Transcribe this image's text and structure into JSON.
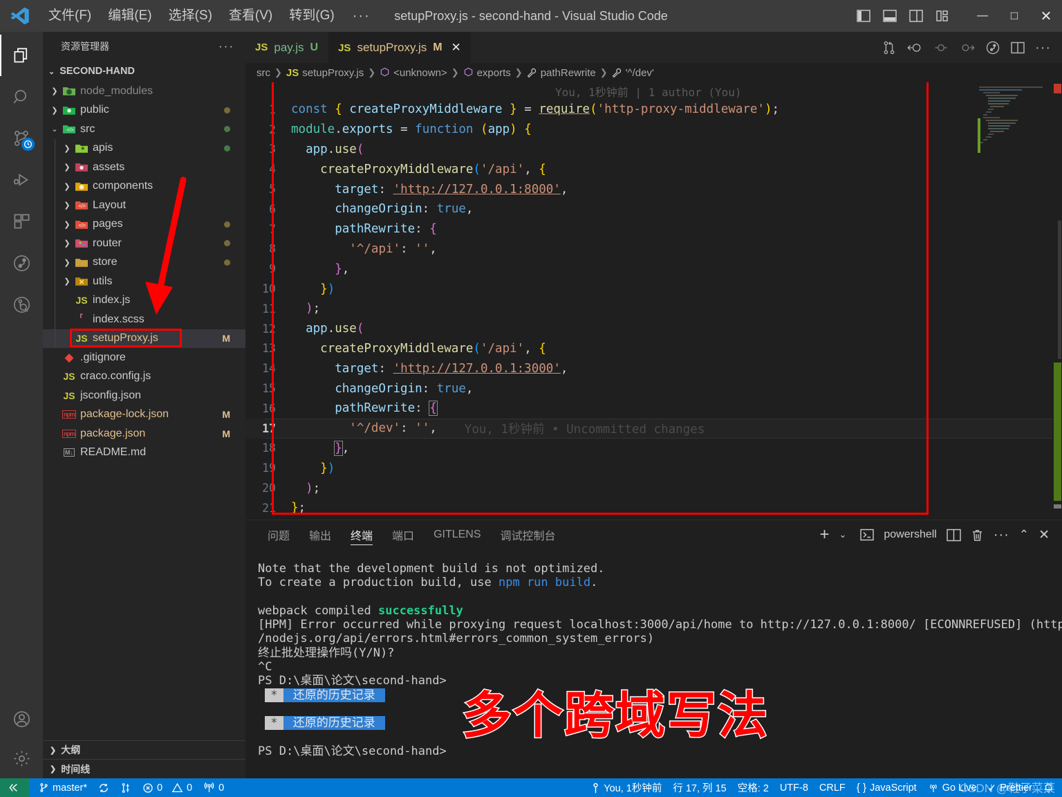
{
  "window": {
    "title": "setupProxy.js - second-hand - Visual Studio Code",
    "menus": [
      "文件(F)",
      "编辑(E)",
      "选择(S)",
      "查看(V)",
      "转到(G)",
      "···"
    ],
    "controls": {
      "minimize": "—",
      "maximize": "□",
      "close": "✕"
    }
  },
  "activitybar": {
    "items": [
      {
        "name": "explorer",
        "icon": "files-icon"
      },
      {
        "name": "search",
        "icon": "search-icon"
      },
      {
        "name": "source-control",
        "icon": "source-control-icon",
        "badge": "clock"
      },
      {
        "name": "run-debug",
        "icon": "run-debug-icon"
      },
      {
        "name": "extensions",
        "icon": "extensions-icon"
      },
      {
        "name": "gitlens",
        "icon": "gitlens-icon"
      },
      {
        "name": "gitlens-inspect",
        "icon": "gitlens-inspect-icon"
      }
    ],
    "bottom": [
      {
        "name": "accounts",
        "icon": "account-icon"
      },
      {
        "name": "settings",
        "icon": "gear-icon"
      }
    ]
  },
  "sidebar": {
    "header": "资源管理器",
    "header_more": "···",
    "root": "SECOND-HAND",
    "tree": [
      {
        "label": "node_modules",
        "depth": 1,
        "type": "folder",
        "icon": "folder-node",
        "expandable": true,
        "expanded": false,
        "dim": true
      },
      {
        "label": "public",
        "depth": 1,
        "type": "folder",
        "icon": "folder-public",
        "expandable": true,
        "expanded": false,
        "dot": "#7a6a3a"
      },
      {
        "label": "src",
        "depth": 1,
        "type": "folder",
        "icon": "folder-src",
        "expandable": true,
        "expanded": true,
        "dot": "#487a48"
      },
      {
        "label": "apis",
        "depth": 2,
        "type": "folder",
        "icon": "folder-api",
        "expandable": true,
        "expanded": false,
        "dot": "#487a48"
      },
      {
        "label": "assets",
        "depth": 2,
        "type": "folder",
        "icon": "folder-assets",
        "expandable": true,
        "expanded": false
      },
      {
        "label": "components",
        "depth": 2,
        "type": "folder",
        "icon": "folder-components",
        "expandable": true,
        "expanded": false
      },
      {
        "label": "Layout",
        "depth": 2,
        "type": "folder",
        "icon": "folder-layout",
        "expandable": true,
        "expanded": false
      },
      {
        "label": "pages",
        "depth": 2,
        "type": "folder",
        "icon": "folder-pages",
        "expandable": true,
        "expanded": false,
        "dot": "#7a6a3a"
      },
      {
        "label": "router",
        "depth": 2,
        "type": "folder",
        "icon": "folder-router",
        "expandable": true,
        "expanded": false,
        "dot": "#7a6a3a"
      },
      {
        "label": "store",
        "depth": 2,
        "type": "folder",
        "icon": "folder-store",
        "expandable": true,
        "expanded": false,
        "dot": "#7a6a3a"
      },
      {
        "label": "utils",
        "depth": 2,
        "type": "folder",
        "icon": "folder-utils",
        "expandable": true,
        "expanded": false
      },
      {
        "label": "index.js",
        "depth": 2,
        "type": "file",
        "icon": "js-icon"
      },
      {
        "label": "index.scss",
        "depth": 2,
        "type": "file",
        "icon": "scss-icon"
      },
      {
        "label": "setupProxy.js",
        "depth": 2,
        "type": "file",
        "icon": "js-icon",
        "badge": "M",
        "selected": true,
        "highlighted": true
      },
      {
        "label": ".gitignore",
        "depth": 1,
        "type": "file",
        "icon": "git-icon"
      },
      {
        "label": "craco.config.js",
        "depth": 1,
        "type": "file",
        "icon": "js-icon"
      },
      {
        "label": "jsconfig.json",
        "depth": 1,
        "type": "file",
        "icon": "jsconfig-icon"
      },
      {
        "label": "package-lock.json",
        "depth": 1,
        "type": "file",
        "icon": "npm-icon",
        "badge": "M"
      },
      {
        "label": "package.json",
        "depth": 1,
        "type": "file",
        "icon": "npm-icon",
        "badge": "M"
      },
      {
        "label": "README.md",
        "depth": 1,
        "type": "file",
        "icon": "markdown-icon"
      }
    ],
    "sections": [
      "大纲",
      "时间线"
    ]
  },
  "tabs": [
    {
      "label": "pay.js",
      "icon": "js-icon",
      "status": "U",
      "active": false
    },
    {
      "label": "setupProxy.js",
      "icon": "js-icon",
      "status": "M",
      "active": true,
      "close": "✕"
    }
  ],
  "editor_actions": [
    {
      "name": "compare-changes-icon"
    },
    {
      "name": "gitlens-open-revision-icon"
    },
    {
      "name": "gitlens-previous-icon"
    },
    {
      "name": "gitlens-next-icon"
    },
    {
      "name": "gitlens-toggle-blame-icon"
    },
    {
      "name": "split-editor-icon"
    },
    {
      "name": "more-actions-icon"
    }
  ],
  "breadcrumbs": [
    {
      "label": "src",
      "icon": null
    },
    {
      "label": "setupProxy.js",
      "icon": "js-icon"
    },
    {
      "label": "<unknown>",
      "icon": "symbol-module-icon"
    },
    {
      "label": "exports",
      "icon": "symbol-module-icon"
    },
    {
      "label": "pathRewrite",
      "icon": "symbol-property-icon"
    },
    {
      "label": "'^/dev'",
      "icon": "symbol-property-icon"
    }
  ],
  "editor": {
    "blame_header": "You, 1秒钟前 | 1 author (You)",
    "inline_blame": "You, 1秒钟前 • Uncommitted changes",
    "current_line": 17,
    "lines": [
      {
        "n": 1,
        "git": "",
        "html": "<span class=\"k-const\">const</span> <span class=\"b1\">{</span> <span class=\"k-var\">createProxyMiddleware</span> <span class=\"b1\">}</span> <span class=\"k-plain\">=</span> <span class=\"k-fn link\">require</span><span class=\"b1\">(</span><span class=\"k-str\">'http-proxy-middleware'</span><span class=\"b1\">)</span><span class=\"k-plain\">;</span>"
      },
      {
        "n": 2,
        "git": "",
        "html": "<span class=\"k-ident\">module</span><span class=\"k-plain\">.</span><span class=\"k-var\">exports</span> <span class=\"k-plain\">=</span> <span class=\"k-const\">function</span> <span class=\"b1\">(</span><span class=\"k-var\">app</span><span class=\"b1\">)</span> <span class=\"b1\">{</span>"
      },
      {
        "n": 3,
        "git": "",
        "html": "  <span class=\"k-var\">app</span><span class=\"k-plain\">.</span><span class=\"k-fn\">use</span><span class=\"b2\">(</span>"
      },
      {
        "n": 4,
        "git": "",
        "html": "    <span class=\"k-fn\">createProxyMiddleware</span><span class=\"b3\">(</span><span class=\"k-str\">'/api'</span><span class=\"k-plain\">,</span> <span class=\"b1\">{</span>"
      },
      {
        "n": 5,
        "git": "",
        "html": "      <span class=\"k-prop\">target</span><span class=\"k-plain\">:</span> <span class=\"k-str link\">'http://127.0.0.1:8000'</span><span class=\"k-plain\">,</span>"
      },
      {
        "n": 6,
        "git": "",
        "html": "      <span class=\"k-prop\">changeOrigin</span><span class=\"k-plain\">:</span> <span class=\"k-bool\">true</span><span class=\"k-plain\">,</span>"
      },
      {
        "n": 7,
        "git": "",
        "html": "      <span class=\"k-prop\">pathRewrite</span><span class=\"k-plain\">:</span> <span class=\"b2\">{</span>"
      },
      {
        "n": 8,
        "git": "",
        "html": "        <span class=\"k-str\">'^/api'</span><span class=\"k-plain\">:</span> <span class=\"k-str\">''</span><span class=\"k-plain\">,</span>"
      },
      {
        "n": 9,
        "git": "",
        "html": "      <span class=\"b2\">}</span><span class=\"k-plain\">,</span>"
      },
      {
        "n": 10,
        "git": "",
        "html": "    <span class=\"b1\">}</span><span class=\"b3\">)</span>"
      },
      {
        "n": 11,
        "git": "",
        "html": "  <span class=\"b2\">)</span><span class=\"k-plain\">;</span>"
      },
      {
        "n": 12,
        "git": "add",
        "html": "  <span class=\"k-var\">app</span><span class=\"k-plain\">.</span><span class=\"k-fn\">use</span><span class=\"b2\">(</span>"
      },
      {
        "n": 13,
        "git": "add",
        "html": "    <span class=\"k-fn\">createProxyMiddleware</span><span class=\"b3\">(</span><span class=\"k-str\">'/api'</span><span class=\"k-plain\">,</span> <span class=\"b1\">{</span>"
      },
      {
        "n": 14,
        "git": "add",
        "html": "      <span class=\"k-prop\">target</span><span class=\"k-plain\">:</span> <span class=\"k-str link\">'http://127.0.0.1:3000'</span><span class=\"k-plain\">,</span>"
      },
      {
        "n": 15,
        "git": "add",
        "html": "      <span class=\"k-prop\">changeOrigin</span><span class=\"k-plain\">:</span> <span class=\"k-bool\">true</span><span class=\"k-plain\">,</span>"
      },
      {
        "n": 16,
        "git": "add",
        "html": "      <span class=\"k-prop\">pathRewrite</span><span class=\"k-plain\">:</span> <span class=\"b2 hl-bracket\">{</span>"
      },
      {
        "n": 17,
        "git": "add",
        "html": "        <span class=\"k-str\">'^/dev'</span><span class=\"k-plain\">:</span> <span class=\"k-str\">''</span><span class=\"k-plain\">,</span>"
      },
      {
        "n": 18,
        "git": "add",
        "html": "      <span class=\"b2 hl-bracket\">}</span><span class=\"k-plain\">,</span>"
      },
      {
        "n": 19,
        "git": "add",
        "html": "    <span class=\"b1\">}</span><span class=\"b3\">)</span>"
      },
      {
        "n": 20,
        "git": "add",
        "html": "  <span class=\"b2\">)</span><span class=\"k-plain\">;</span>"
      },
      {
        "n": 21,
        "git": "",
        "html": "<span class=\"b1\">}</span><span class=\"k-plain\">;</span>"
      }
    ]
  },
  "panel": {
    "tabs": [
      "问题",
      "输出",
      "终端",
      "端口",
      "GITLENS",
      "调试控制台"
    ],
    "active_tab": "终端",
    "terminal_name": "powershell",
    "actions": [
      {
        "name": "new-terminal-icon",
        "label": "+"
      },
      {
        "name": "terminal-dropdown-icon",
        "label": "⌄"
      },
      {
        "name": "split-terminal-icon"
      },
      {
        "name": "kill-terminal-icon"
      },
      {
        "name": "panel-more-icon",
        "label": "···"
      },
      {
        "name": "maximize-panel-icon",
        "label": "⌃"
      },
      {
        "name": "close-panel-icon",
        "label": "✕"
      }
    ],
    "terminal_lines": [
      {
        "type": "plain",
        "text": "Note that the development build is not optimized."
      },
      {
        "type": "npm",
        "pre": "To create a production build, use ",
        "cmd": "npm run build",
        "post": "."
      },
      {
        "type": "blank",
        "text": ""
      },
      {
        "type": "success",
        "pre": "webpack compiled ",
        "ok": "successfully"
      },
      {
        "type": "plain",
        "text": "[HPM] Error occurred while proxying request localhost:3000/api/home to http://127.0.0.1:8000/ [ECONNREFUSED] (https:/"
      },
      {
        "type": "plain",
        "text": "/nodejs.org/api/errors.html#errors_common_system_errors)"
      },
      {
        "type": "plain",
        "text": "终止批处理操作吗(Y/N)?"
      },
      {
        "type": "plain",
        "text": "^C"
      },
      {
        "type": "plain",
        "text": "PS D:\\桌面\\论文\\second-hand>"
      },
      {
        "type": "history",
        "star": "*",
        "label": "还原的历史记录"
      },
      {
        "type": "blank",
        "text": ""
      },
      {
        "type": "history",
        "star": "*",
        "label": "还原的历史记录"
      },
      {
        "type": "blank",
        "text": ""
      },
      {
        "type": "prompt",
        "text": "PS D:\\桌面\\论文\\second-hand>"
      }
    ]
  },
  "annotation": {
    "big_text": "多个跨域写法"
  },
  "statusbar": {
    "remote_icon": "remote-icon",
    "left": [
      {
        "name": "branch",
        "icon": "branch-icon",
        "label": "master*"
      },
      {
        "name": "sync",
        "icon": "sync-icon",
        "label": ""
      },
      {
        "name": "gitlens-compare",
        "icon": "compare-icon",
        "label": ""
      },
      {
        "name": "errors",
        "icon": "error-icon",
        "label": "0"
      },
      {
        "name": "warnings",
        "icon": "warning-icon",
        "label": "0"
      },
      {
        "name": "ports",
        "icon": "radio-tower-icon",
        "label": "0"
      }
    ],
    "right": [
      {
        "name": "gitlens-blame",
        "icon": "gitlens-blame-icon",
        "label": "You, 1秒钟前"
      },
      {
        "name": "cursor-position",
        "label": "行 17, 列 15"
      },
      {
        "name": "indentation",
        "label": "空格: 2"
      },
      {
        "name": "encoding",
        "label": "UTF-8"
      },
      {
        "name": "eol",
        "label": "CRLF"
      },
      {
        "name": "language-mode",
        "icon": "braces-icon",
        "label": "JavaScript"
      },
      {
        "name": "go-live",
        "icon": "broadcast-icon",
        "label": "Go Live"
      },
      {
        "name": "prettier",
        "icon": "check-icon",
        "label": "Prettier"
      },
      {
        "name": "notifications",
        "icon": "bell-icon",
        "label": ""
      }
    ]
  },
  "watermark": "CSDN @鞋子菜菜"
}
